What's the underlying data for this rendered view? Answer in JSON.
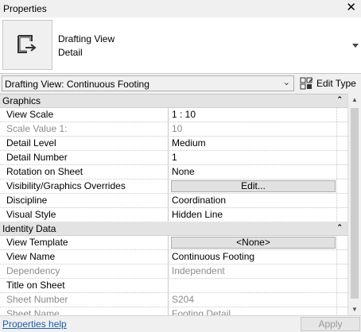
{
  "window": {
    "title": "Properties",
    "close_glyph": "✕"
  },
  "type_selector": {
    "icon": "drafting-view-icon",
    "family": "Drafting View",
    "type": "Detail"
  },
  "instance_selector": {
    "value": "Drafting View: Continuous Footing",
    "edit_type_label": "Edit Type"
  },
  "groups": [
    {
      "title": "Graphics",
      "collapse_glyph": "⌃",
      "rows": [
        {
          "name": "View Scale",
          "value": "1 : 10"
        },
        {
          "name": "Scale Value    1:",
          "value": "10",
          "disabled": true
        },
        {
          "name": "Detail Level",
          "value": "Medium"
        },
        {
          "name": "Detail Number",
          "value": "1"
        },
        {
          "name": "Rotation on Sheet",
          "value": "None"
        },
        {
          "name": "Visibility/Graphics Overrides",
          "value": "Edit...",
          "button": true
        },
        {
          "name": "Discipline",
          "value": "Coordination"
        },
        {
          "name": "Visual Style",
          "value": "Hidden Line"
        }
      ]
    },
    {
      "title": "Identity Data",
      "collapse_glyph": "⌃",
      "rows": [
        {
          "name": "View Template",
          "value": "<None>",
          "button": true
        },
        {
          "name": "View Name",
          "value": "Continuous Footing"
        },
        {
          "name": "Dependency",
          "value": "Independent",
          "disabled": true
        },
        {
          "name": "Title on Sheet",
          "value": ""
        },
        {
          "name": "Sheet Number",
          "value": "S204",
          "disabled": true
        },
        {
          "name": "Sheet Name",
          "value": "Footing Detail",
          "disabled": true
        }
      ]
    }
  ],
  "footer": {
    "help_link": "Properties help",
    "apply_label": "Apply"
  },
  "colors": {
    "link": "#1f5fa8",
    "group_header_bg": "#e3e3e3",
    "disabled_text": "#8c8c8c"
  }
}
